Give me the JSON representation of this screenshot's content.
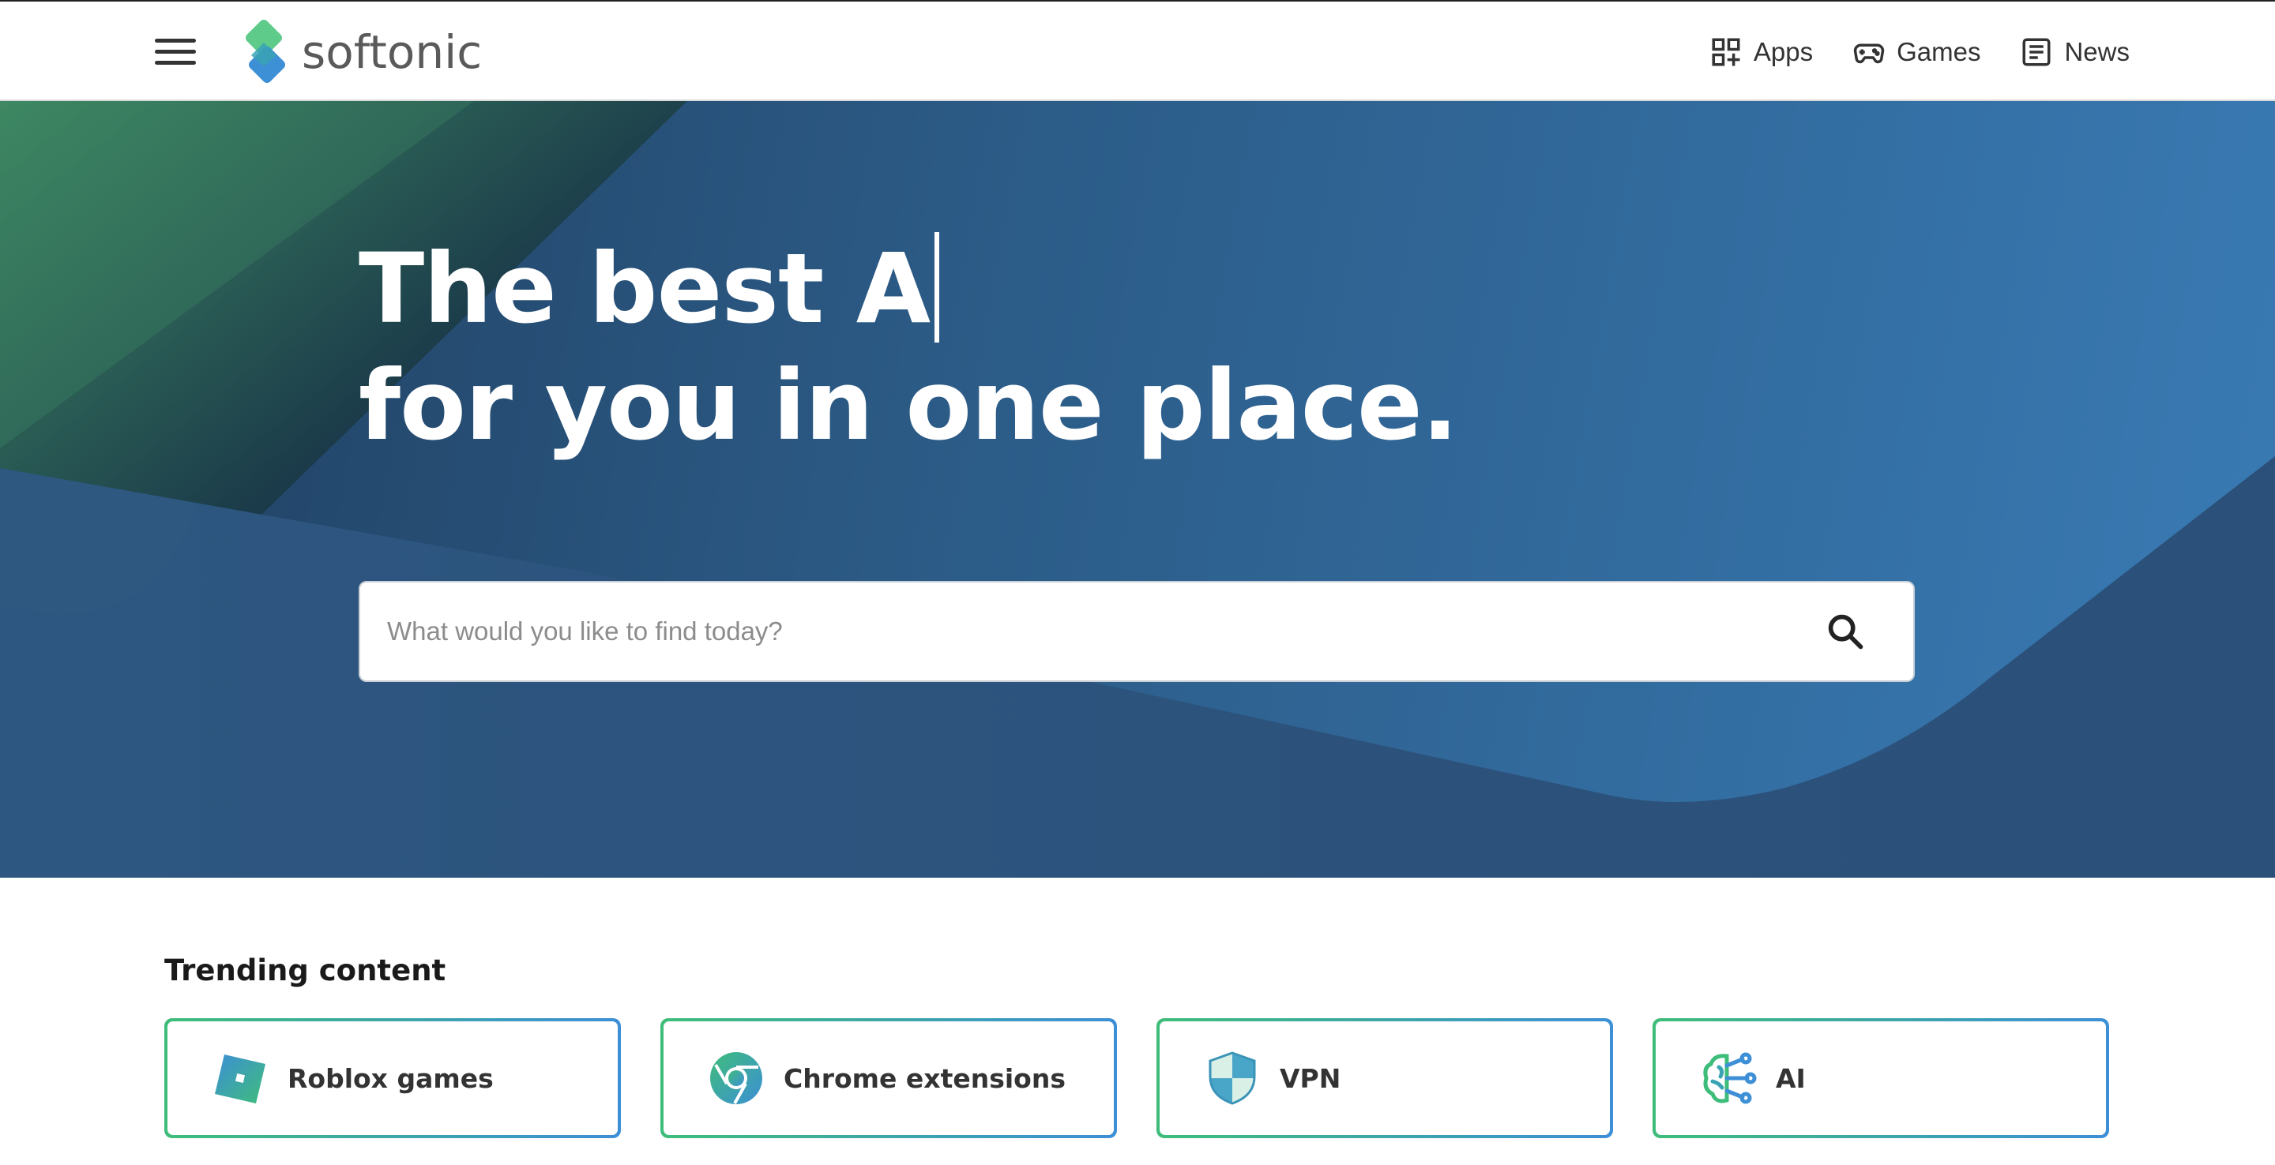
{
  "header": {
    "logo_text": "softonic",
    "nav": [
      {
        "label": "Apps",
        "icon": "apps-grid-icon"
      },
      {
        "label": "Games",
        "icon": "gamepad-icon"
      },
      {
        "label": "News",
        "icon": "newspaper-icon"
      }
    ]
  },
  "hero": {
    "title_line1": "The best A",
    "title_line2": "for you in one place.",
    "search": {
      "placeholder": "What would you like to find today?",
      "value": ""
    }
  },
  "trending": {
    "title": "Trending content",
    "items": [
      {
        "label": "Roblox games",
        "icon": "roblox-icon"
      },
      {
        "label": "Chrome extensions",
        "icon": "chrome-icon"
      },
      {
        "label": "VPN",
        "icon": "shield-icon"
      },
      {
        "label": "AI",
        "icon": "brain-circuit-icon"
      }
    ]
  },
  "colors": {
    "brand_green": "#3ebd7a",
    "brand_blue": "#3d8fd6",
    "hero_blue": "#2b5a85"
  }
}
